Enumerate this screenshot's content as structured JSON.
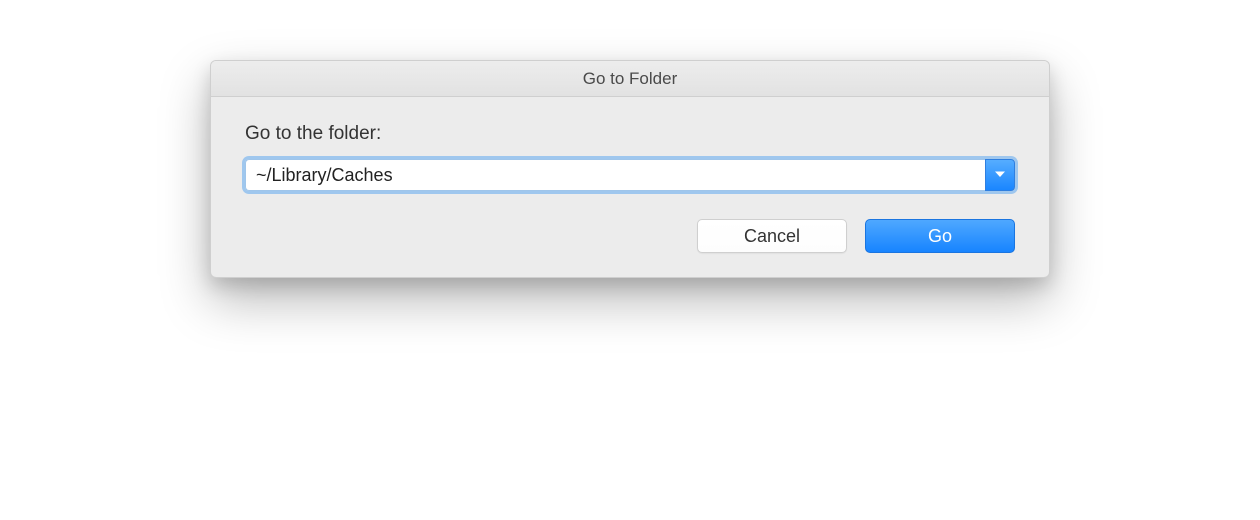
{
  "dialog": {
    "title": "Go to Folder",
    "label": "Go to the folder:",
    "path_value": "~/Library/Caches",
    "buttons": {
      "cancel": "Cancel",
      "go": "Go"
    }
  }
}
